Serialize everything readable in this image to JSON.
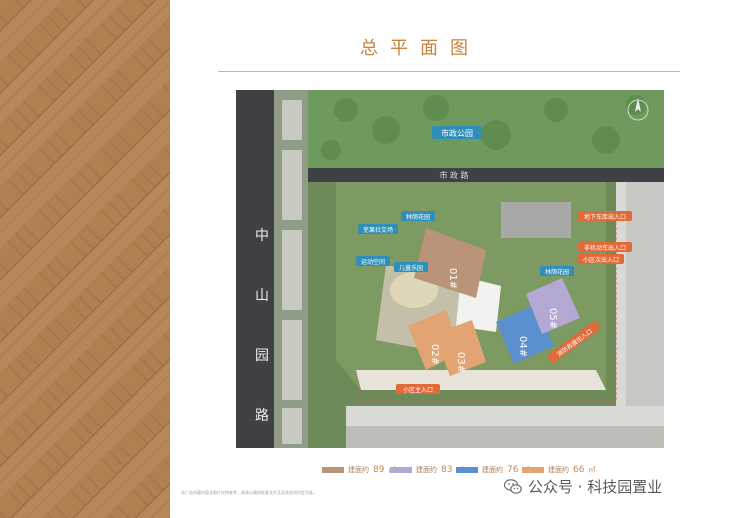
{
  "title": "总平面图",
  "map_labels": {
    "park": "市政公园",
    "road_top": "市 政 路",
    "road_left_chars": [
      "中",
      "山",
      "园",
      "路"
    ],
    "garden_1": "林荫花园",
    "social": "芜果社交场",
    "sport": "运动空间",
    "kids": "儿童乐园",
    "garden_2": "林荫花园",
    "entry_underground": "地下车库出入口",
    "entry_motor": "非机动车出入口",
    "entry_secondary": "小区次出入口",
    "entry_main": "小区主入口",
    "entry_fire": "消防救援出入口"
  },
  "buildings": {
    "b1": "01#",
    "b2": "02#",
    "b3": "03#",
    "b4": "04#",
    "b5": "05#"
  },
  "colors": {
    "tan": "#b99478",
    "purple": "#b4a8d4",
    "blue": "#5b8fce",
    "orange": "#e1a472",
    "accent": "#e06a38"
  },
  "legend": [
    {
      "label": "建面约",
      "value": "89",
      "unit": "㎡"
    },
    {
      "label": "建面约",
      "value": "83",
      "unit": "㎡"
    },
    {
      "label": "建面约",
      "value": "76",
      "unit": "㎡"
    },
    {
      "label": "建面约",
      "value": "66",
      "unit": "㎡"
    }
  ],
  "footnote": "本广告所载内容及图片仅供参考，具体以政府批准文件及买卖合同约定为准。",
  "watermark": {
    "text": "公众号 · 科技园置业",
    "icon": "wechat-icon"
  }
}
